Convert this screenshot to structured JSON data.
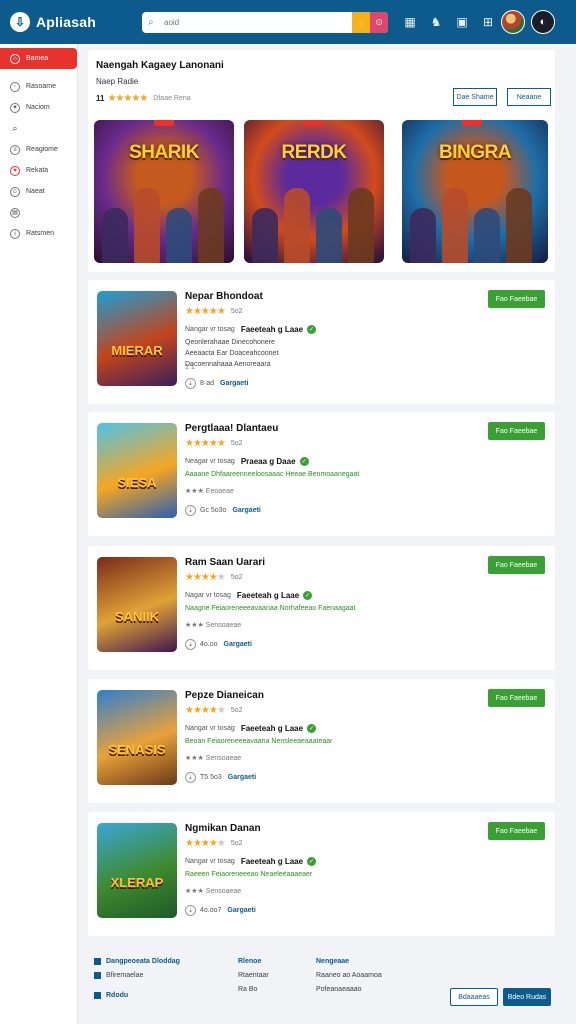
{
  "app": {
    "name": "Apliasah",
    "logo_glyph": "⇩"
  },
  "search": {
    "placeholder": "aoid"
  },
  "header_icons": [
    "grid-icon",
    "gamepad-icon",
    "bell-icon",
    "apps-icon"
  ],
  "sidebar": {
    "items": [
      {
        "label": "Bamea",
        "icon": "home-icon",
        "active": true
      },
      {
        "label": "Rasoame",
        "icon": "compass-icon"
      },
      {
        "label": "Naciom",
        "icon": "gear-icon"
      },
      {
        "label": "",
        "icon": "search-icon"
      },
      {
        "label": "Reagiome",
        "icon": "chat-icon"
      },
      {
        "label": "Rekata",
        "icon": "heart-icon"
      },
      {
        "label": "Naeat",
        "icon": "user-icon"
      },
      {
        "label": "",
        "icon": "list-icon"
      },
      {
        "label": "Ratsmen",
        "icon": "info-icon"
      }
    ]
  },
  "hero": {
    "title": "Naengah Kagaey Lanonani",
    "subtitle": "Naep Radie",
    "rating_num": "11",
    "stars": 5,
    "rating_text": "Dfaae Rena",
    "btn1": "Dae Shame",
    "btn2": "Neaane",
    "banners": [
      {
        "title": "SHARIK",
        "colors": [
          "#6a2b8c",
          "#c45a1e",
          "#2a0d30"
        ]
      },
      {
        "title": "RERDK",
        "colors": [
          "#d14b1d",
          "#5b2a9c",
          "#1e0d3d"
        ]
      },
      {
        "title": "BINGRA",
        "colors": [
          "#1f6ea8",
          "#c6581f",
          "#151a40"
        ]
      }
    ]
  },
  "games": [
    {
      "name": "Nepar Bhondoat",
      "stars": 5,
      "rating": "5o2",
      "meta": "Nangar vr tosag",
      "dev": "Faeeteah g Laae",
      "lines": [
        "Qeonlerahaae Dinecohonere",
        "Aeeaacta Ear Doaceahcoonet",
        "Dacoennahaaa Aenoreaara"
      ],
      "small": "1  1",
      "downloads": "8·ad",
      "category": "Gargaeti",
      "btn": "Fao Faeebae",
      "thumb_title": "MIERAR",
      "thumb_colors": [
        "#1b9fd8",
        "#c2451c",
        "#3b1f5a"
      ]
    },
    {
      "name": "Pergtlaaa! Dlantaeu",
      "stars": 5,
      "rating": "5o2",
      "meta": "Neagar vr tosag",
      "dev": "Praeaa  g Daae",
      "lines": [
        "Aaaane Dhfaareenneeloosaaac Heeae Benmoaanegaat"
      ],
      "small": "★★★  Eeoaeae",
      "downloads": "Gc 5o3o",
      "category": "Gargaeti",
      "btn": "Fao Faeebae",
      "thumb_title": "SIESA",
      "thumb_colors": [
        "#4fc3e8",
        "#f5a623",
        "#2b5fb0"
      ]
    },
    {
      "name": "Ram Saan Uarari",
      "stars": 4,
      "rating": "5o2",
      "meta": "Nagar vr tosag",
      "dev": "Faeeteah g Laae",
      "lines": [
        "Naagne Feiaoreneeeavaanaa Norhafeeao Faenaagaat"
      ],
      "small": "★★★  Sensoaeae",
      "downloads": "4o.oo",
      "category": "Gargaeti",
      "btn": "Fao Faeebae",
      "thumb_title": "SANIIK",
      "thumb_colors": [
        "#7a2a18",
        "#e0a236",
        "#401650"
      ]
    },
    {
      "name": "Pepze Dianeican",
      "stars": 4,
      "rating": "5o2",
      "meta": "Nangar vr tosag",
      "dev": "Faeeteah g Laae",
      "lines": [
        "Beoan Feiaoreneeeavaana Nensleeaeaaateaar"
      ],
      "small": "★★★  Sensoaeae",
      "downloads": "T5 5o3",
      "category": "Gargaeti",
      "btn": "Fao Faeebae",
      "thumb_title": "SENASIS",
      "thumb_colors": [
        "#2f7fd0",
        "#e9a13a",
        "#6b3a16"
      ]
    },
    {
      "name": "Ngmikan Danan",
      "stars": 4,
      "rating": "5o2",
      "meta": "Nangar vr tosag",
      "dev": "Faeeteah g Laae",
      "lines": [
        "Raeeen Feiaoreneeeao Neaeleeaaaeaer"
      ],
      "small": "★★★  Sensoaeae",
      "downloads": "4o.oo7",
      "category": "Gargaeti",
      "btn": "Fao Faeebae",
      "thumb_title": "XLERAP",
      "thumb_colors": [
        "#3aa6d6",
        "#3f8a2e",
        "#1d5a2a"
      ]
    }
  ],
  "footer": {
    "col1": [
      "Dangpeoeata Dloddag",
      "Bfiremaelae",
      "Rdodu"
    ],
    "col2_head": "Rlenoe",
    "col2": [
      "Rtaentaar",
      "Ra  Bo"
    ],
    "col3_head": "Nengeaae",
    "col3": [
      "Raaneo ao Aoaamoa",
      "Pofeanaeaaao"
    ],
    "btn1": "Bdaaaeas",
    "btn2": "Bdeo Rudas"
  }
}
